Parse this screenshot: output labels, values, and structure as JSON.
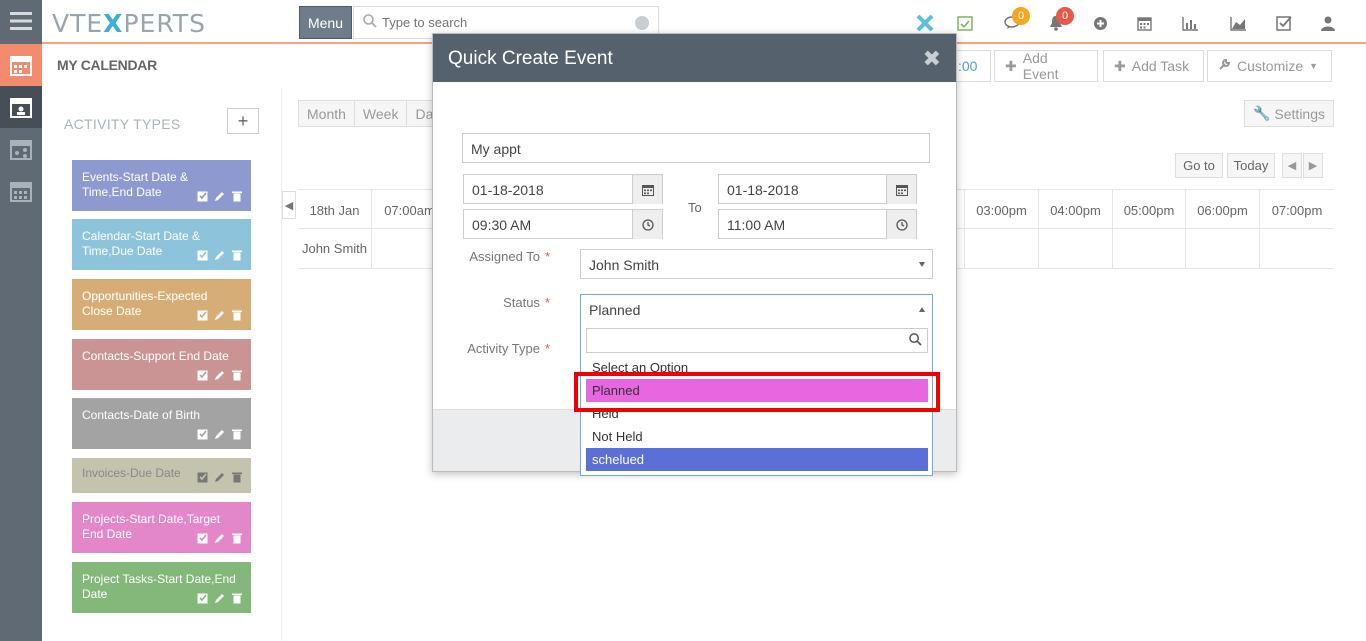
{
  "brand": {
    "logo_pre": "VTE",
    "logo_x": "X",
    "logo_post": "PERTS"
  },
  "topbar": {
    "menu_label": "Menu",
    "search_placeholder": "Type to search",
    "chat_badge": "0",
    "bell_badge": "0"
  },
  "page": {
    "title": "MY CALENDAR"
  },
  "header_buttons": {
    "time_fragment": ":00",
    "add_event": "Add Event",
    "add_task": "Add Task",
    "customize": "Customize"
  },
  "sidebar": {
    "title": "ACTIVITY TYPES",
    "add": "+",
    "activities": [
      {
        "label": "Events-Start Date & Time,End Date",
        "color": "#8e99d0"
      },
      {
        "label": "Calendar-Start Date & Time,Due Date",
        "color": "#8dc4dc"
      },
      {
        "label": "Opportunities-Expected Close Date",
        "color": "#d7ad77"
      },
      {
        "label": "Contacts-Support End Date",
        "color": "#cb9494"
      },
      {
        "label": "Contacts-Date of Birth",
        "color": "#a3a3a3"
      },
      {
        "label": "Invoices-Due Date",
        "color": "#c3c3ae"
      },
      {
        "label": "Projects-Start Date,Target End Date",
        "color": "#e487c9"
      },
      {
        "label": "Project Tasks-Start Date,End Date",
        "color": "#83b87a"
      }
    ]
  },
  "calendar": {
    "views": [
      "Month",
      "Week",
      "Da"
    ],
    "settings": "Settings",
    "goto": "Go to",
    "today": "Today",
    "date": "18th Jan",
    "user": "John Smith",
    "hours_left": [
      "07:00am"
    ],
    "hours_right": [
      "03:00pm",
      "04:00pm",
      "05:00pm",
      "06:00pm",
      "07:00pm"
    ]
  },
  "modal": {
    "title": "Quick Create Event",
    "subject": "My appt",
    "start_date": "01-18-2018",
    "start_time": "09:30 AM",
    "to_label": "To",
    "end_date": "01-18-2018",
    "end_time": "11:00 AM",
    "assigned_label": "Assigned To",
    "assigned_value": "John Smith",
    "status_label": "Status",
    "status_value": "Planned",
    "activity_label": "Activity Type",
    "required": "*",
    "options": [
      "Select an Option",
      "Planned",
      "Held",
      "Not Held",
      "schelued"
    ]
  }
}
